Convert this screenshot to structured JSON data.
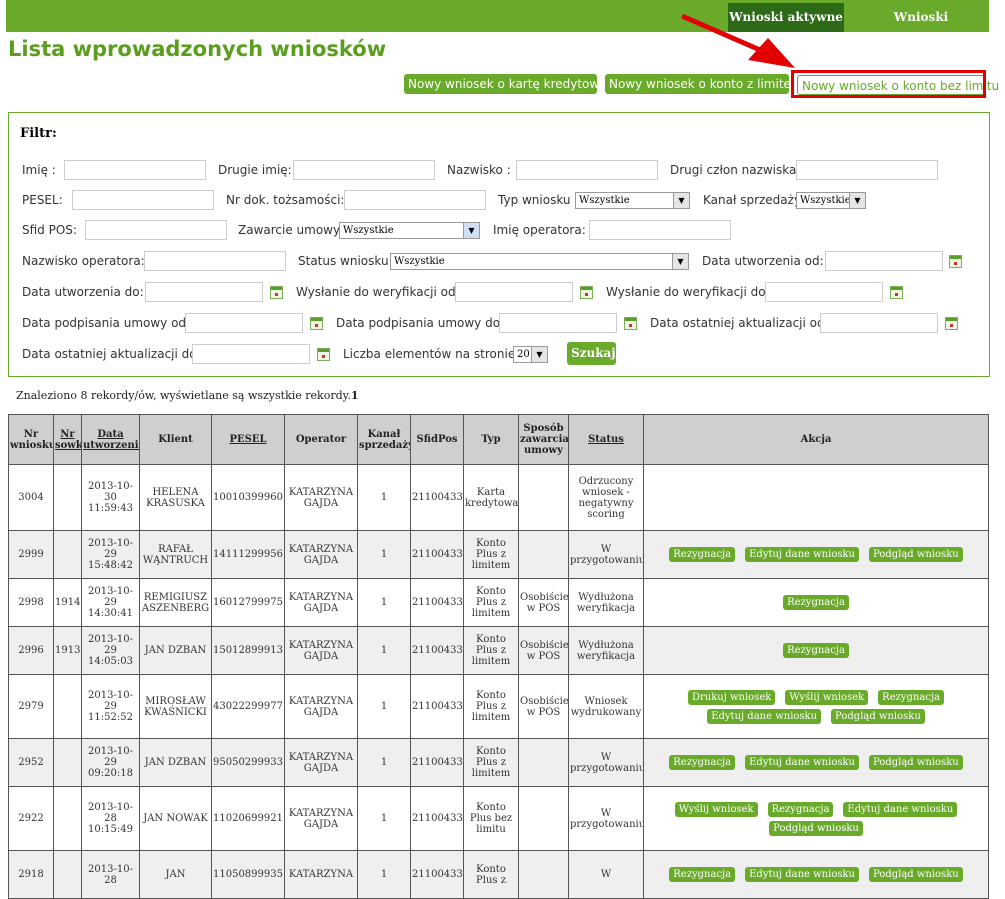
{
  "tabs": {
    "active": "Wnioski aktywne",
    "other": "Wnioski zakończone"
  },
  "title": "Lista wprowadzonych wniosków",
  "buttons": {
    "card": "Nowy wniosek o kartę kredytową",
    "limit": "Nowy wniosek o konto z limitem",
    "nolimit": "Nowy wniosek o konto bez limitu"
  },
  "filter": {
    "title": "Filtr:",
    "imie": "Imię :",
    "drugie_imie": "Drugie imię:",
    "nazwisko": "Nazwisko :",
    "drugi_czlon": "Drugi człon nazwiska:",
    "pesel": "PESEL:",
    "nr_dok": "Nr dok. tożsamości:",
    "typ": "Typ wniosku",
    "typ_val": "Wszystkie",
    "kanal": "Kanał sprzedaży",
    "kanal_val": "Wszystkie",
    "sfid": "Sfid POS:",
    "zawarcie": "Zawarcie umowy",
    "zawarcie_val": "Wszystkie",
    "imie_op": "Imię operatora:",
    "nazwisko_op": "Nazwisko operatora:",
    "status": "Status wniosku",
    "status_val": "Wszystkie",
    "utw_od": "Data utworzenia od:",
    "utw_do": "Data utworzenia do:",
    "wys_od": "Wysłanie do weryfikacji od:",
    "wys_do": "Wysłanie do weryfikacji do:",
    "podp_od": "Data podpisania umowy od:",
    "podp_do": "Data podpisania umowy do:",
    "akt_od": "Data ostatniej aktualizacji od:",
    "akt_do": "Data ostatniej aktualizacji do:",
    "liczba": "Liczba elementów na stronie:",
    "liczba_val": "20",
    "szukaj": "Szukaj"
  },
  "found": "Znaleziono 8 rekordy/ów, wyświetlane są wszystkie rekordy.",
  "found_page": "1",
  "columns": [
    "Nr wniosku",
    "Nr sowk",
    "Data utworzenia",
    "Klient",
    "PESEL",
    "Operator",
    "Kanał sprzedaży",
    "SfidPos",
    "Typ",
    "Sposób zawarcia umowy",
    "Status",
    "Akcja"
  ],
  "rows": [
    {
      "nr": "3004",
      "sowk": "",
      "date": "2013-10-30",
      "time": "11:59:43",
      "klient": "HELENA KRASUSKA",
      "pesel": "10010399960",
      "operator": "KATARZYNA GAJDA",
      "kanal": "1",
      "sfid": "21100433",
      "typ": "Karta kredytowa",
      "sposob": "",
      "status": "Odrzucony wniosek - negatywny scoring",
      "actions": []
    },
    {
      "nr": "2999",
      "sowk": "",
      "date": "2013-10-29",
      "time": "15:48:42",
      "klient": "RAFAŁ WĄNTRUCH",
      "pesel": "14111299956",
      "operator": "KATARZYNA GAJDA",
      "kanal": "1",
      "sfid": "21100433",
      "typ": "Konto Plus z limitem",
      "sposob": "",
      "status": "W przygotowaniu",
      "actions": [
        "Rezygnacja",
        "Edytuj dane wniosku",
        "Podgląd wniosku"
      ]
    },
    {
      "nr": "2998",
      "sowk": "1914",
      "date": "2013-10-29",
      "time": "14:30:41",
      "klient": "REMIGIUSZ ASZENBERG",
      "pesel": "16012799975",
      "operator": "KATARZYNA GAJDA",
      "kanal": "1",
      "sfid": "21100433",
      "typ": "Konto Plus z limitem",
      "sposob": "Osobiście w POS",
      "status": "Wydłużona weryfikacja",
      "actions": [
        "Rezygnacja"
      ]
    },
    {
      "nr": "2996",
      "sowk": "1913",
      "date": "2013-10-29",
      "time": "14:05:03",
      "klient": "JAN DZBAN",
      "pesel": "15012899913",
      "operator": "KATARZYNA GAJDA",
      "kanal": "1",
      "sfid": "21100433",
      "typ": "Konto Plus z limitem",
      "sposob": "Osobiście w POS",
      "status": "Wydłużona weryfikacja",
      "actions": [
        "Rezygnacja"
      ]
    },
    {
      "nr": "2979",
      "sowk": "",
      "date": "2013-10-29",
      "time": "11:52:52",
      "klient": "MIROSŁAW KWAŚNICKI",
      "pesel": "43022299977",
      "operator": "KATARZYNA GAJDA",
      "kanal": "1",
      "sfid": "21100433",
      "typ": "Konto Plus z limitem",
      "sposob": "Osobiście w POS",
      "status": "Wniosek wydrukowany",
      "actions": [
        "Drukuj wniosek",
        "Wyślij wniosek",
        "Rezygnacja",
        "Edytuj dane wniosku",
        "Podgląd wniosku"
      ]
    },
    {
      "nr": "2952",
      "sowk": "",
      "date": "2013-10-29",
      "time": "09:20:18",
      "klient": "JAN DZBAN",
      "pesel": "95050299933",
      "operator": "KATARZYNA GAJDA",
      "kanal": "1",
      "sfid": "21100433",
      "typ": "Konto Plus z limitem",
      "sposob": "",
      "status": "W przygotowaniu",
      "actions": [
        "Rezygnacja",
        "Edytuj dane wniosku",
        "Podgląd wniosku"
      ]
    },
    {
      "nr": "2922",
      "sowk": "",
      "date": "2013-10-28",
      "time": "10:15:49",
      "klient": "JAN NOWAK",
      "pesel": "11020699921",
      "operator": "KATARZYNA GAJDA",
      "kanal": "1",
      "sfid": "21100433",
      "typ": "Konto Plus bez limitu",
      "sposob": "",
      "status": "W przygotowaniu",
      "actions": [
        "Wyślij wniosek",
        "Rezygnacja",
        "Edytuj dane wniosku",
        "Podgląd wniosku"
      ]
    },
    {
      "nr": "2918",
      "sowk": "",
      "date": "2013-10-28",
      "time": "",
      "klient": "JAN",
      "pesel": "11050899935",
      "operator": "KATARZYNA",
      "kanal": "1",
      "sfid": "21100433",
      "typ": "Konto Plus z",
      "sposob": "",
      "status": "W",
      "actions": [
        "Rezygnacja",
        "Edytuj dane wniosku",
        "Podgląd wniosku"
      ]
    }
  ]
}
